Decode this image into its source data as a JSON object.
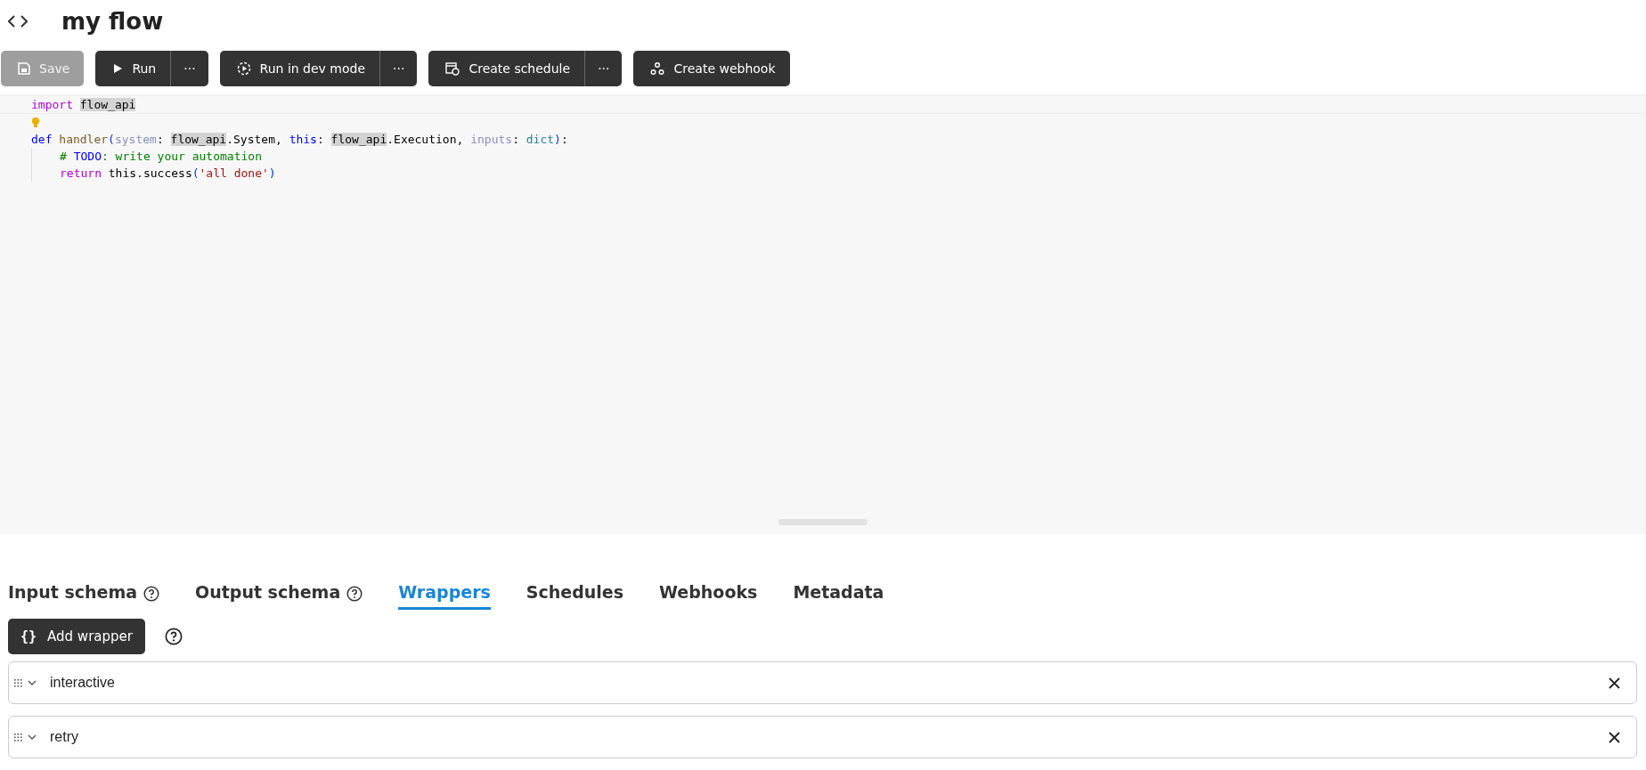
{
  "header": {
    "title": "my flow"
  },
  "toolbar": [
    {
      "label": "Save",
      "kind": "save",
      "disabled": true
    },
    {
      "label": "Run",
      "kind": "run",
      "disabled": false,
      "menu_label": "···"
    },
    {
      "label": "Run in dev mode",
      "kind": "dev",
      "disabled": false,
      "menu_label": "···"
    },
    {
      "label": "Create schedule",
      "kind": "schedule",
      "disabled": false,
      "menu_label": "···"
    },
    {
      "label": "Create webhook",
      "kind": "webhook",
      "disabled": false
    }
  ],
  "editor": {
    "lines": [
      {
        "current": true,
        "bulb": false,
        "guide": false,
        "tokens": [
          {
            "text": "import ",
            "kind": "keyword2"
          },
          {
            "text": "flow_api",
            "kind": "highlight"
          }
        ]
      },
      {
        "current": false,
        "bulb": true,
        "guide": false
      },
      {
        "current": false,
        "bulb": false,
        "guide": false,
        "tokens": [
          {
            "text": "def ",
            "kind": "keyword"
          },
          {
            "text": "handler",
            "kind": "function"
          },
          {
            "text": "(",
            "kind": "bracket"
          },
          {
            "text": "system",
            "kind": "param"
          },
          {
            "text": ": ",
            "kind": "plain"
          },
          {
            "text": "flow_api",
            "kind": "highlight"
          },
          {
            "text": ".System, ",
            "kind": "plain"
          },
          {
            "text": "this",
            "kind": "keyword"
          },
          {
            "text": ": ",
            "kind": "plain"
          },
          {
            "text": "flow_api",
            "kind": "highlight"
          },
          {
            "text": ".Execution, ",
            "kind": "plain"
          },
          {
            "text": "inputs",
            "kind": "param"
          },
          {
            "text": ": ",
            "kind": "plain"
          },
          {
            "text": "dict",
            "kind": "type"
          },
          {
            "text": ")",
            "kind": "bracket"
          },
          {
            "text": ":",
            "kind": "plain"
          }
        ]
      },
      {
        "current": false,
        "bulb": false,
        "guide": true,
        "tokens": [
          {
            "text": "# ",
            "kind": "comment"
          },
          {
            "text": "TODO",
            "kind": "todo"
          },
          {
            "text": ": write your automation",
            "kind": "comment"
          }
        ]
      },
      {
        "current": false,
        "bulb": false,
        "guide": true,
        "tokens": [
          {
            "text": "return",
            "kind": "keyword2"
          },
          {
            "text": " this.success",
            "kind": "plain"
          },
          {
            "text": "(",
            "kind": "bracket"
          },
          {
            "text": "'all done'",
            "kind": "string"
          },
          {
            "text": ")",
            "kind": "bracket"
          }
        ]
      }
    ]
  },
  "tabs": [
    {
      "label": "Input schema",
      "help": true,
      "selected": false
    },
    {
      "label": "Output schema",
      "help": true,
      "selected": false
    },
    {
      "label": "Wrappers",
      "help": false,
      "selected": true
    },
    {
      "label": "Schedules",
      "help": false,
      "selected": false
    },
    {
      "label": "Webhooks",
      "help": false,
      "selected": false
    },
    {
      "label": "Metadata",
      "help": false,
      "selected": false
    }
  ],
  "wrappers": {
    "add_label": "Add wrapper",
    "add_icon": "{}",
    "items": [
      {
        "name": "interactive"
      },
      {
        "name": "retry"
      }
    ]
  }
}
